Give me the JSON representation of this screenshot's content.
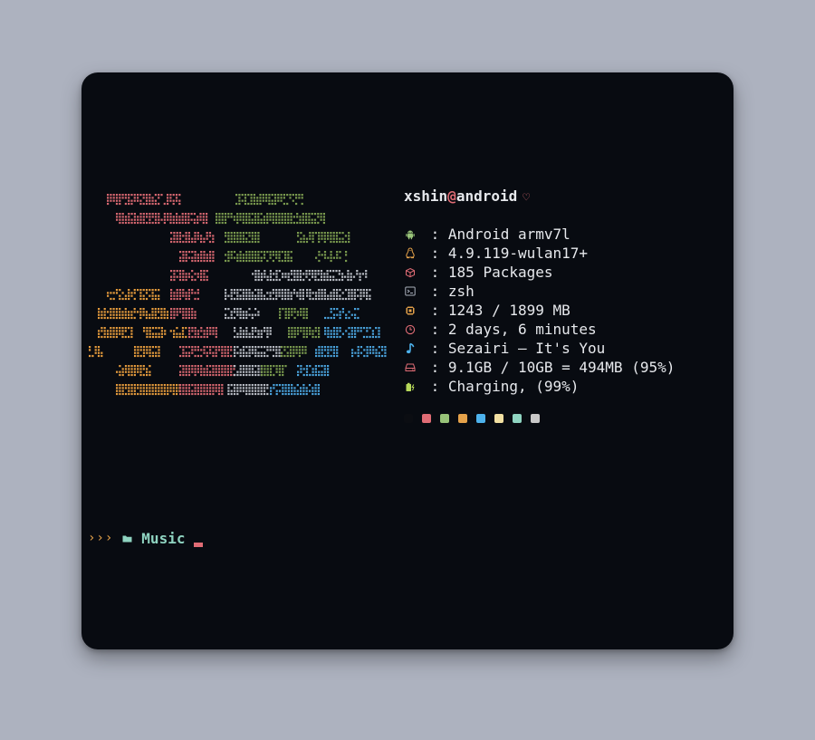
{
  "terminal": {
    "user": "xshin",
    "at": "@",
    "host": "android",
    "heart": "♡",
    "info": [
      {
        "icon": "android-icon",
        "sep": " : ",
        "value": "Android armv7l",
        "color": "#98c379"
      },
      {
        "icon": "linux-tux-icon",
        "sep": " : ",
        "value": "4.9.119-wulan17+",
        "color": "#e5a24a"
      },
      {
        "icon": "package-icon",
        "sep": " : ",
        "value": "185 Packages",
        "color": "#e06c75"
      },
      {
        "icon": "terminal-icon",
        "sep": " : ",
        "value": "zsh",
        "color": "#aab0bc"
      },
      {
        "icon": "memory-icon",
        "sep": " : ",
        "value": "1243 / 1899 MB",
        "color": "#e5a24a"
      },
      {
        "icon": "clock-icon",
        "sep": " : ",
        "value": "2 days, 6 minutes",
        "color": "#e06c75"
      },
      {
        "icon": "music-note-icon",
        "sep": " : ",
        "value": "Sezairi — It's You",
        "color": "#4db2ec"
      },
      {
        "icon": "disk-icon",
        "sep": " : ",
        "value": "9.1GB / 10GB = 494MB (95%)",
        "color": "#e06c75"
      },
      {
        "icon": "battery-charging-icon",
        "sep": " : ",
        "value": "Charging, (99%)",
        "color": "#b6d85a"
      }
    ],
    "palette": [
      "#0b0d12",
      "#e06c75",
      "#98c379",
      "#e5a24a",
      "#4db2ec",
      "#f2e0a2",
      "#8fd4c1",
      "#c9c9c9"
    ],
    "prompt": {
      "arrows": "›››",
      "directory": "Music"
    }
  }
}
